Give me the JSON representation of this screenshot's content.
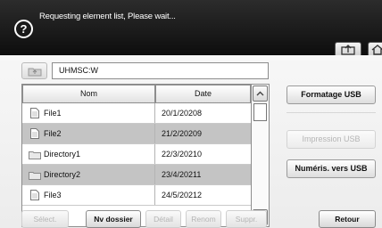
{
  "header": {
    "help_glyph": "?",
    "message": "Requesting element list, Please wait..."
  },
  "path": {
    "value": "UHMSC:W"
  },
  "table": {
    "columns": [
      "Nom",
      "Date"
    ],
    "rows": [
      {
        "name": "File1",
        "date": "20/1/20208",
        "type": "file"
      },
      {
        "name": "File2",
        "date": "21/2/20209",
        "type": "file"
      },
      {
        "name": "Directory1",
        "date": "22/3/20210",
        "type": "directory"
      },
      {
        "name": "Directory2",
        "date": "23/4/20211",
        "type": "directory"
      },
      {
        "name": "File3",
        "date": "24/5/20212",
        "type": "file"
      }
    ]
  },
  "side_buttons": {
    "format": "Formatage USB",
    "print": "Impression USB",
    "scan": "Numéris. vers USB"
  },
  "bottom_buttons": {
    "select": "Sélect.",
    "new_folder": "Nv dossier",
    "detail": "Détail",
    "rename": "Renom",
    "delete": "Suppr.",
    "back": "Retour"
  },
  "icons": {
    "help": "help-icon",
    "export": "export-icon",
    "home": "home-icon",
    "folder_up": "folder-up-icon",
    "file": "file-icon",
    "directory": "folder-icon",
    "scroll_up": "chevron-up-icon",
    "scroll_down": "chevron-down-icon"
  },
  "colors": {
    "header_bg": "#111111",
    "row_alt": "#c4c4c4",
    "disabled_text": "#b5b5b5"
  }
}
